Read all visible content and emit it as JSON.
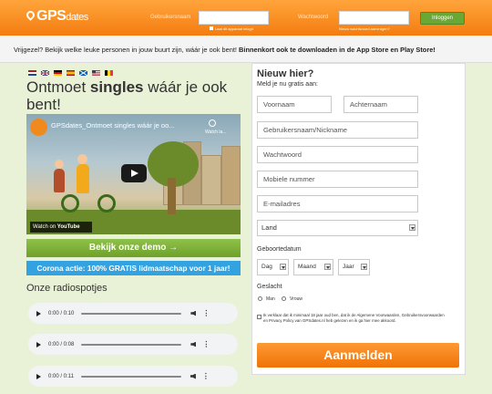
{
  "header": {
    "logo_text": "GPS",
    "logo_small": "dates",
    "username_label": "Gebruikersnaam",
    "password_label": "Wachtwoord",
    "remember_label": "Laat dit apparaat inlogd",
    "forgot_label": "Nieuw wachtwoord aanvragen?",
    "login_button": "Inloggen",
    "colors": {
      "top": "#ffa53c",
      "bottom": "#f47c10"
    }
  },
  "subheader": {
    "text_plain": "Vrijgezel? Bekijk welke leuke personen in jouw buurt zijn, wáár je ook bent!",
    "text_bold": "Binnenkort ook te downloaden in de App Store en Play Store!"
  },
  "languages": [
    "nl-flag",
    "gb-flag",
    "de-flag",
    "es-flag",
    "scotland-flag",
    "us-flag",
    "be-flag"
  ],
  "headline": {
    "part1": "Ontmoet ",
    "bold": "singles",
    "part2": " wáár je ook bent!"
  },
  "video": {
    "title": "GPSdates_Ontmoet singles wáár je oo...",
    "watch_later": "Watch la...",
    "watch_on": "Watch on",
    "youtube": "YouTube"
  },
  "demo_button": "Bekijk onze demo →",
  "corona_banner": "Corona actie: 100% GRATIS lidmaatschap voor 1 jaar!",
  "radio": {
    "title": "Onze radiospotjes",
    "tracks": [
      {
        "time": "0:00 / 0:10"
      },
      {
        "time": "0:00 / 0:08"
      },
      {
        "time": "0:00 / 0:11"
      }
    ]
  },
  "signup": {
    "title": "Nieuw hier?",
    "subtitle": "Meld je nu gratis aan:",
    "firstname_placeholder": "Voornaam",
    "lastname_placeholder": "Achternaam",
    "username_placeholder": "Gebruikersnaam/Nickname",
    "password_placeholder": "Wachtwoord",
    "phone_placeholder": "Mobiele nummer",
    "email_placeholder": "E-mailadres",
    "country_value": "Land",
    "birthdate_label": "Geboortedatum",
    "day_value": "Dag",
    "month_value": "Maand",
    "year_value": "Jaar",
    "gender_label": "Geslacht",
    "gender_male": "Man",
    "gender_female": "Vrouw",
    "terms_text": "Ik verklaar dat ik minimaal 18 jaar oud ben, dat ik de Algemene Voorwaarden, Gebruikersvoorwaarden en Privacy Policy van GPSdates.nl heb gelezen en ik ga hier mee akkoord.",
    "submit_button": "Aanmelden"
  }
}
